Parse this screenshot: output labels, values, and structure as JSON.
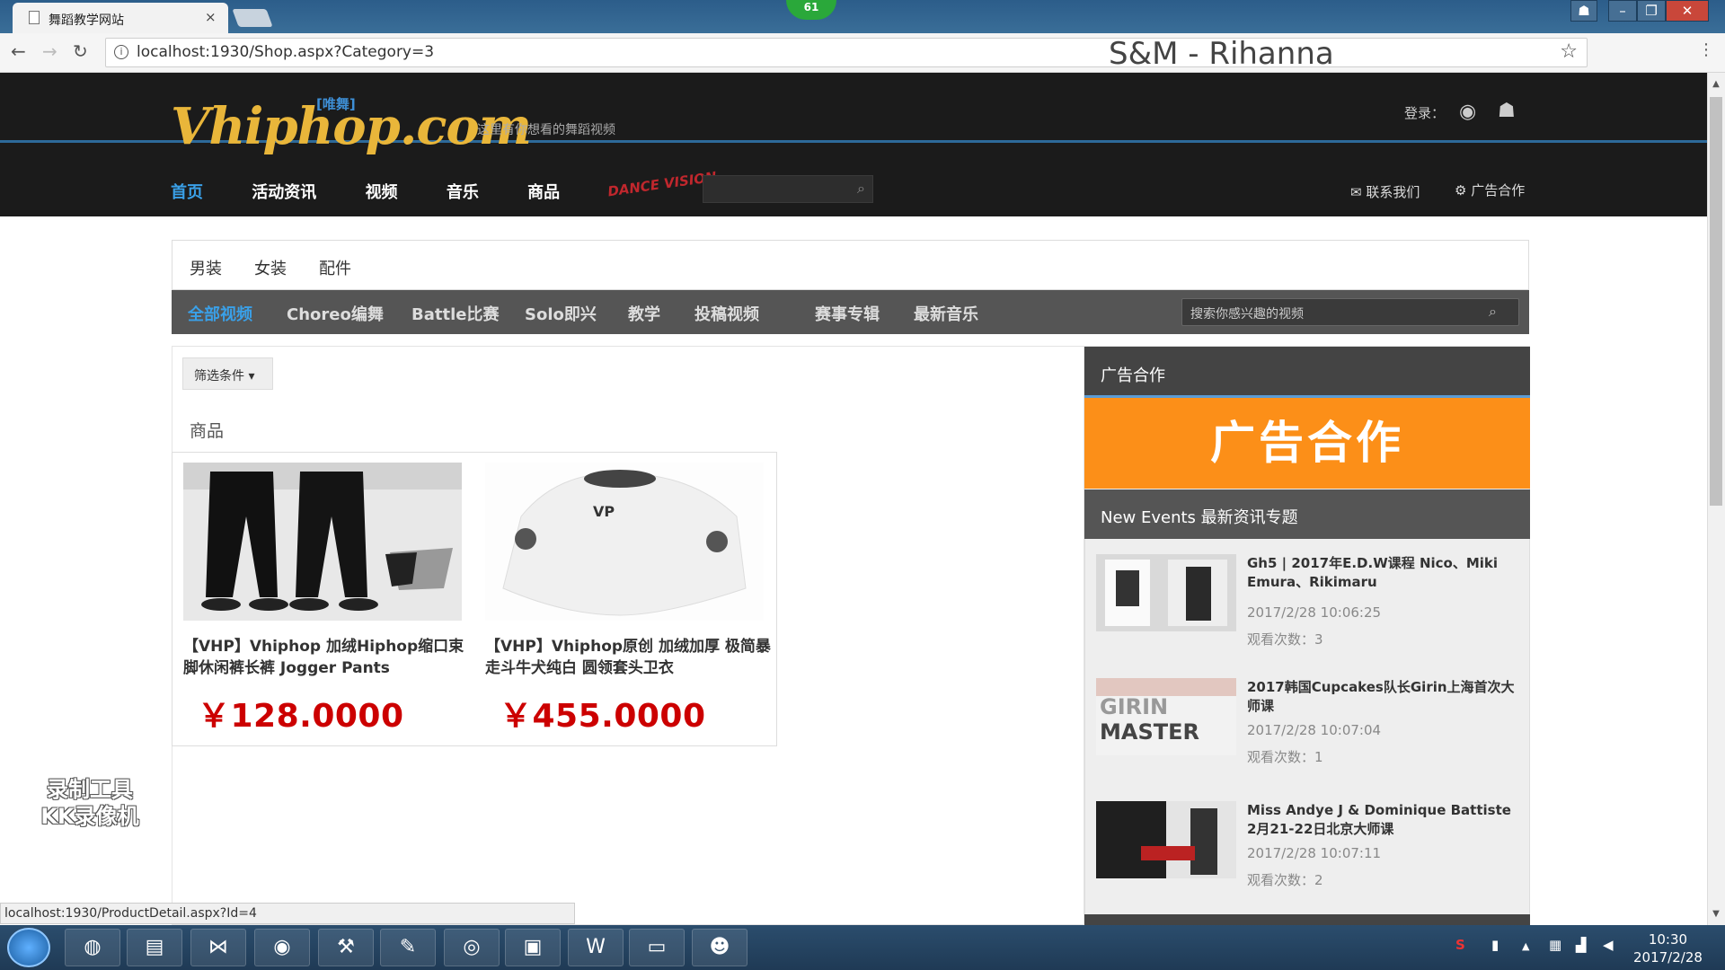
{
  "browser": {
    "tab_title": "舞蹈教学网站",
    "tab_close": "×",
    "notification_count": "61",
    "url": "localhost:1930/Shop.aspx?Category=3",
    "now_playing": "S&M - Rihanna",
    "status_url": "localhost:1930/ProductDetail.aspx?Id=4"
  },
  "header": {
    "logo_text": "Vhiphop.com",
    "logo_tag": "[唯舞]",
    "slogan": "这里有你想看的舞蹈视频",
    "login_label": "登录：",
    "nav": [
      "首页",
      "活动资讯",
      "视频",
      "音乐",
      "商品"
    ],
    "dance_logo": "DANCE VISION",
    "contact_label": "联系我们",
    "ad_label": "广告合作"
  },
  "categories": [
    "男装",
    "女装",
    "配件"
  ],
  "subnav": [
    "全部视频",
    "Choreo编舞",
    "Battle比赛",
    "Solo即兴",
    "教学",
    "投稿视频",
    "赛事专辑",
    "最新音乐"
  ],
  "video_search_placeholder": "搜索你感兴趣的视频",
  "filter_label": "筛选条件",
  "section_title": "商品",
  "products": [
    {
      "title": "【VHP】Vhiphop 加绒Hiphop缩口束脚休闲裤长裤 Jogger Pants",
      "price": "￥128.0000"
    },
    {
      "title": "【VHP】Vhiphop原创 加绒加厚 极简暴走斗牛犬纯白 圆领套头卫衣",
      "price": "￥455.0000"
    }
  ],
  "sidebar": {
    "ad_header": "广告合作",
    "ad_banner": "广告合作",
    "events_header": "New Events 最新资讯专题",
    "events": [
      {
        "title": "Gh5 | 2017年E.D.W课程 Nico、Miki Emura、Rikimaru",
        "date": "2017/2/28 10:06:25",
        "views": "观看次数：3"
      },
      {
        "title": "2017韩国Cupcakes队长Girin上海首次大师课",
        "date": "2017/2/28 10:07:04",
        "views": "观看次数：1",
        "image_text": "GIRIN MASTER"
      },
      {
        "title": "Miss Andye J & Dominique Battiste 2月21-22日北京大师课",
        "date": "2017/2/28 10:07:11",
        "views": "观看次数：2"
      }
    ]
  },
  "watermark": "录制工具 KK录像机",
  "clock": {
    "time": "10:30",
    "date": "2017/2/28"
  },
  "colors": {
    "price_red": "#cc0000",
    "nav_active": "#3aa0e8",
    "ad_orange": "#fc8f18",
    "header_dark": "#1b1b1b"
  }
}
